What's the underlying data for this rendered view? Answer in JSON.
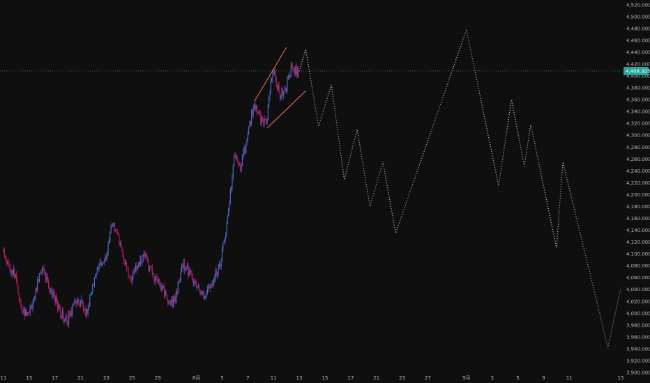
{
  "chart_data": {
    "type": "candlestick",
    "y_axis": {
      "ylim": [
        3900,
        4528
      ],
      "ticks": [
        "3,900.000",
        "3,920.000",
        "3,940.000",
        "3,960.000",
        "3,980.000",
        "4,000.000",
        "4,020.000",
        "4,040.000",
        "4,060.000",
        "4,080.000",
        "4,100.000",
        "4,120.000",
        "4,140.000",
        "4,160.000",
        "4,180.000",
        "4,200.000",
        "4,220.000",
        "4,240.000",
        "4,260.000",
        "4,280.000",
        "4,300.000",
        "4,320.000",
        "4,340.000",
        "4,360.000",
        "4,380.000",
        "4,400.000",
        "4,420.000",
        "4,440.000",
        "4,460.000",
        "4,480.000",
        "4,500.000",
        "4,520.000"
      ],
      "tick_values": [
        3900,
        3920,
        3940,
        3960,
        3980,
        4000,
        4020,
        4040,
        4060,
        4080,
        4100,
        4120,
        4140,
        4160,
        4180,
        4200,
        4220,
        4240,
        4260,
        4280,
        4300,
        4320,
        4340,
        4360,
        4380,
        4400,
        4420,
        4440,
        4460,
        4480,
        4500,
        4520
      ]
    },
    "x_axis": {
      "range": [
        0,
        59
      ],
      "ticks": [
        {
          "label": "11",
          "x": 0
        },
        {
          "label": "15",
          "x": 4
        },
        {
          "label": "17",
          "x": 8
        },
        {
          "label": "21",
          "x": 12
        },
        {
          "label": "23",
          "x": 16
        },
        {
          "label": "25",
          "x": 20
        },
        {
          "label": "29",
          "x": 24
        },
        {
          "label": "8月",
          "x": 30
        },
        {
          "label": "5",
          "x": 34
        },
        {
          "label": "7",
          "x": 38
        },
        {
          "label": "11",
          "x": 42
        },
        {
          "label": "13",
          "x": 46
        },
        {
          "label": "15",
          "x": 50
        },
        {
          "label": "17",
          "x": 54
        },
        {
          "label": "21",
          "x": 58
        },
        {
          "label": "23",
          "x": 62
        },
        {
          "label": "27",
          "x": 66
        },
        {
          "label": "9月",
          "x": 72
        },
        {
          "label": "3",
          "x": 76
        },
        {
          "label": "5",
          "x": 80
        },
        {
          "label": "9",
          "x": 84
        },
        {
          "label": "11",
          "x": 88
        },
        {
          "label": "15",
          "x": 96
        }
      ]
    },
    "candles_close": [
      4105,
      4080,
      4060,
      4010,
      3995,
      4030,
      4075,
      4050,
      4030,
      4000,
      3985,
      4010,
      4020,
      4000,
      4040,
      4080,
      4090,
      4150,
      4130,
      4085,
      4060,
      4080,
      4100,
      4070,
      4055,
      4040,
      4010,
      4030,
      4080,
      4070,
      4050,
      4030,
      4040,
      4060,
      4090,
      4160,
      4260,
      4245,
      4290,
      4350,
      4330,
      4320,
      4410,
      4370,
      4380,
      4415,
      4405
    ],
    "current_price": {
      "value": 4408.325,
      "label": "4,408.325"
    },
    "channel": {
      "upper": [
        [
          39,
          4357
        ],
        [
          44,
          4448
        ]
      ],
      "lower": [
        [
          41,
          4312
        ],
        [
          47,
          4375
        ]
      ]
    },
    "projection": [
      [
        46,
        4408
      ],
      [
        47,
        4445
      ],
      [
        49,
        4315
      ],
      [
        51,
        4385
      ],
      [
        53,
        4225
      ],
      [
        55,
        4310
      ],
      [
        57,
        4180
      ],
      [
        59,
        4255
      ],
      [
        61,
        4135
      ],
      [
        72,
        4478
      ],
      [
        77,
        4215
      ],
      [
        79,
        4360
      ],
      [
        81,
        4248
      ],
      [
        82,
        4318
      ],
      [
        86,
        4110
      ],
      [
        87,
        4255
      ],
      [
        94,
        3942
      ],
      [
        96,
        4043
      ]
    ],
    "colors": {
      "background": "#0f0f0f",
      "up": "#4c6fd1",
      "down": "#c2185b",
      "channel": "#f07c54",
      "projection": "#e0e0e0",
      "price_line": "#26a69a",
      "price_label_bg": "#26a69a",
      "axis_text": "#b2b5be"
    }
  }
}
